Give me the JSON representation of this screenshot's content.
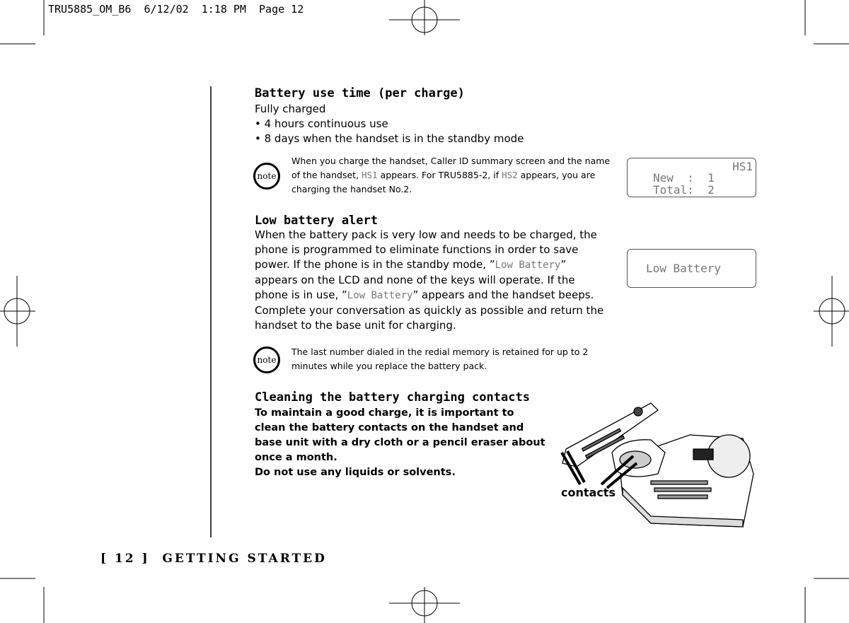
{
  "slug": "TRU5885_OM_B6  6/12/02  1:18 PM  Page 12",
  "battery_use": {
    "title": "Battery use time (per charge)",
    "line1": "Fully charged",
    "bullets": [
      "4 hours continuous use",
      "8 days when the handset is in the standby mode"
    ]
  },
  "note1": {
    "badge": "note",
    "p1": "When you charge the handset, Caller ID summary screen and the name",
    "p2a": "of the handset, ",
    "hs1": "HS1",
    "p2b": " appears. For TRU5885-2, if ",
    "hs2": "HS2",
    "p2c": " appears, you are",
    "p3": "charging the handset No.2."
  },
  "lcd1": {
    "line1": "HS1",
    "line2": "New  :  1",
    "line3": "Total:  2"
  },
  "low_battery": {
    "title": "Low battery alert",
    "l1": "When the battery pack is very low and needs to be charged, the",
    "l2": "phone is programmed to eliminate functions in order to save",
    "l3a": "power. If the phone is in the standby mode, ”",
    "lcdword": "Low Battery",
    "l3b": "”",
    "l4": "appears on the LCD and none of the keys will operate. If the",
    "l5a": "phone is in use, ”",
    "l5b": "” appears and the handset beeps.",
    "l6": "Complete your conversation as quickly as possible and return the",
    "l7": "handset to the base unit for charging."
  },
  "lcd2": {
    "line1": "Low Battery"
  },
  "note2": {
    "badge": "note",
    "p1": "The last number dialed in the redial memory is retained for up to 2",
    "p2": "minutes while you replace the battery pack."
  },
  "cleaning": {
    "title": "Cleaning the battery charging contacts",
    "lines": [
      "To maintain a good charge, it is important to",
      "clean the battery contacts on the handset and",
      "base unit with a dry cloth or a pencil eraser about",
      "once a month.",
      "Do not use any liquids or solvents."
    ]
  },
  "illustration": {
    "label": "contacts"
  },
  "footer": "[ 12 ]  GETTING STARTED"
}
